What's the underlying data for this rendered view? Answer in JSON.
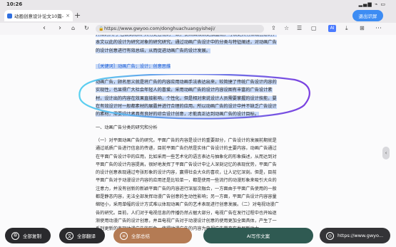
{
  "status": {
    "time": "10:26",
    "system_icons": "▂▄▆ ⌁ ▭"
  },
  "tabbar": {
    "tab_title": "动画创意设计论文10篇-...",
    "tab_close": "×",
    "new_tab": "+",
    "exit_recognition": "退出识屏"
  },
  "navbar": {
    "url": "https://www.gwyoo.com/donghuachuangyisheji/",
    "ai_badge": "AI"
  },
  "article": {
    "p_intro": "开始的入门“包装式动画”具有更容易的一致，使画面效果更加直观，可以更具有体现创意的，本文以此的设计为研究对象的研究研究，通过动画广告设计中的分类与特征阐述，对动画广告的设计创意进行有效总结，从而促进动画广告的设计发展。",
    "keywords_label": "［关键词］",
    "keywords": "动画广告；设计；创意思维",
    "p_selected": "动画广告，顾名思义就是将广告的内容应用动画手法表达出来，较简捷了传统广告设计内容的实现性，也显得广大社会年轻人的喜爱。采用动画广告的设计内容设图有丰富的广告设计素材，设计出的内容在效果直接影响，个性化，但是相对来说设计人员需要掌握的设计技能，要在有效设计时一般都素材的展露并进行合理的应用。所以动画广告的设计中并不缺乏广告设计的素材，需要设计者具有良好的综合设计创意，才能真正达到动画广告的设计目标。",
    "heading_1": "一、动画广告分类的研究和分析",
    "p_body_1": "（一）对平面动画广告的研究。平面广告的内容是设计的重要部分，广告设计的发展前期就是通过纸质广告进行信息的传递，目前平面广告仍然是实体广告设计的主要内容。动画广告通过在平面广告设计中的应用，比如采用一些艺术化的语言表达与抽象化的形象描述，从而达到对平面广告的设计内容提高，很好地发挥了平面广告设计中让人深刻记忆的表现优势，平面广告的设计创意表现通过夸张形象的设计内容，赢得社会大众的喜欢，让人记忆深刻。但是，目前平面广告对于动漫设计内容的应用还是比较单一，都是使用一些流行的动漫形象来吸引大众的注意力，并没有创新的新颖平面广告的内容进行深层次融合，一方面由于平面广告使用的一般都是静态内容，无法全部发挥动漫广告创意的生动性影响；另一方面，平面广告设计内容容量缩短小，采用单幅的设计方式难以体现动画广告的艺术表现进行创意发展。（二）对电视动漫广告的研究。目前，人们对于电视信息的传播仍然占据大部分，电视广告在发行过程中也开始逐渐使用动漫广告的设计创意，并且电视广告对于动漫设计创意的使用更加全面具体，产生了一系列更新的表现动漫广告的形象，使得动漫广告的内容为电视广告带来在发展新动力。"
  },
  "bottombar": {
    "copy_all": "全部复制",
    "translate_all": "全部翻译",
    "summarize_all": "全部总结",
    "ai_writing": "AI写作文案",
    "url_short": "https://www.gwyo..."
  },
  "colors": {
    "accent": "#3d8cf3",
    "selection": "#c6d8f7",
    "lasso_start": "#5ad1f0",
    "lasso_end": "#7b3fe0"
  },
  "icons": {
    "back": "back-icon",
    "forward": "forward-icon",
    "home": "home-icon",
    "refresh": "refresh-icon",
    "globe": "globe-icon"
  }
}
